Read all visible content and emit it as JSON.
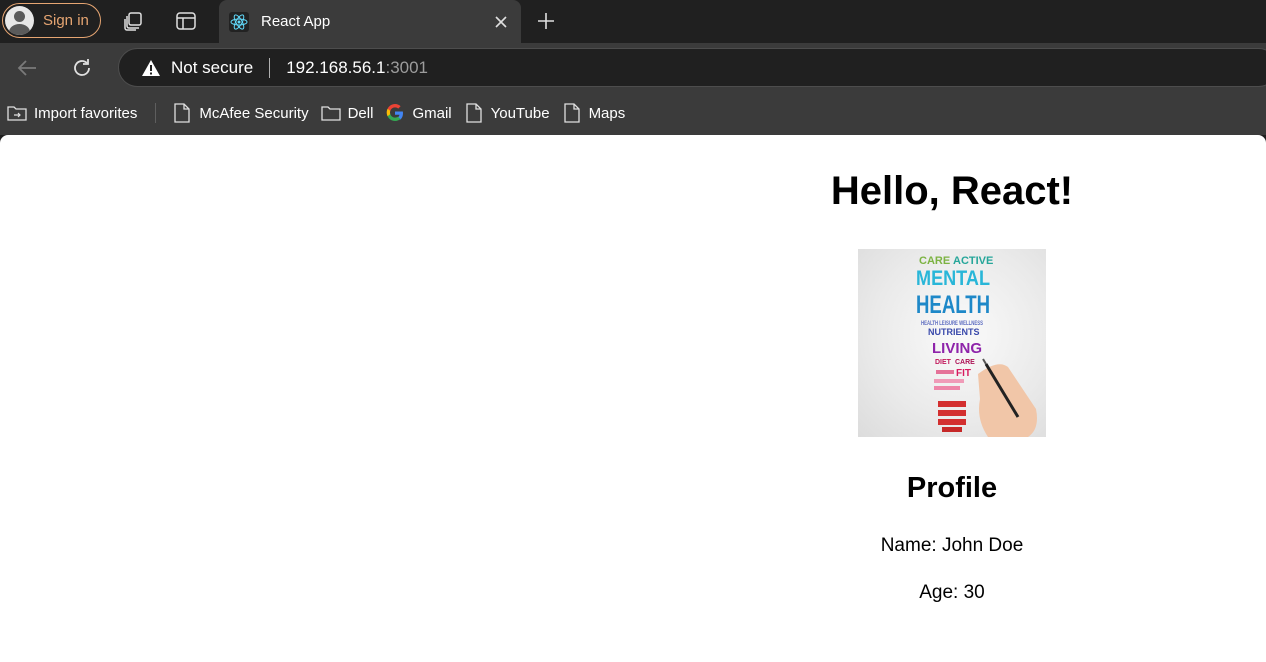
{
  "browser": {
    "signin_label": "Sign in",
    "tab_title": "React App",
    "security_label": "Not secure",
    "url_host": "192.168.56.1",
    "url_port": ":3001"
  },
  "bookmarks": [
    {
      "label": "Import favorites",
      "icon": "import-icon"
    },
    {
      "label": "McAfee Security",
      "icon": "page-icon"
    },
    {
      "label": "Dell",
      "icon": "folder-icon"
    },
    {
      "label": "Gmail",
      "icon": "google-icon"
    },
    {
      "label": "YouTube",
      "icon": "page-icon"
    },
    {
      "label": "Maps",
      "icon": "page-icon"
    }
  ],
  "app": {
    "heading": "Hello, React!",
    "image_words": [
      "CARE",
      "ACTIVE",
      "MENTAL",
      "HEALTH",
      "HEALTH LEISURE WELLNESS",
      "NUTRIENTS",
      "LIVING",
      "DIET",
      "CARE",
      "FIT"
    ],
    "profile": {
      "title": "Profile",
      "name": "Name: John Doe",
      "age": "Age: 30"
    }
  },
  "colors": {
    "accent_signin": "#e6a572",
    "chrome_dark": "#202020",
    "chrome_mid": "#3b3b3b"
  }
}
